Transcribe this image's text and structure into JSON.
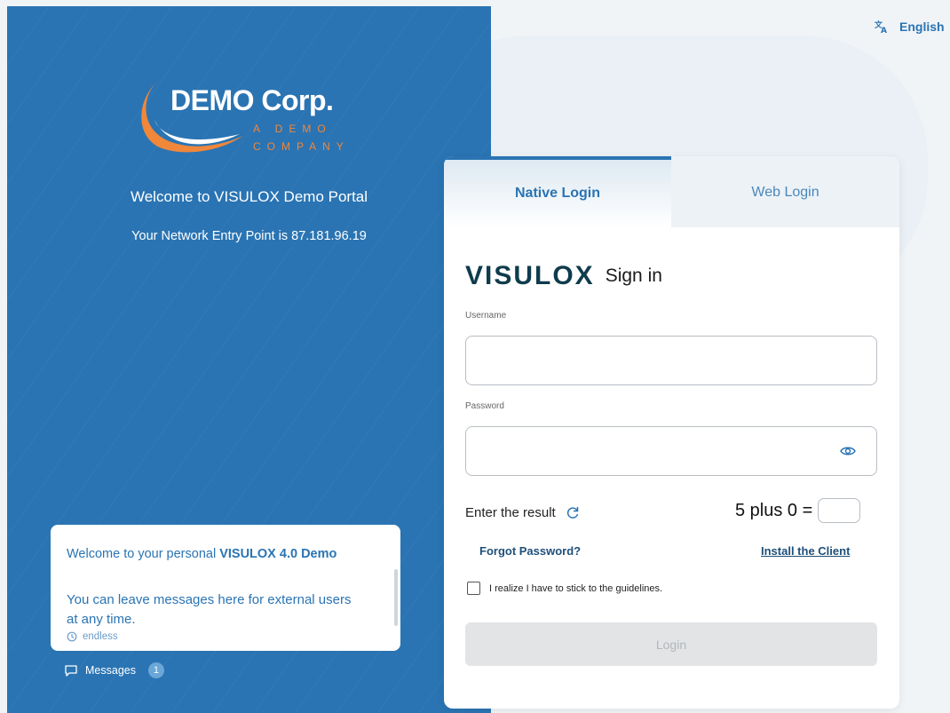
{
  "branding": {
    "company_name": "DEMO Corp.",
    "tagline_line1": "A DEMO",
    "tagline_line2": "COMPANY",
    "accent_orange": "#f0873a",
    "primary_blue": "#2a74b3"
  },
  "welcome": {
    "title": "Welcome to VISULOX Demo Portal",
    "entry_point": "Your Network Entry Point is 87.181.96.19"
  },
  "message_box": {
    "line1_prefix": "Welcome to your personal ",
    "line1_bold": "VISULOX 4.0 Demo",
    "line2": "You can leave messages here for external users at any time.",
    "expiry": "endless",
    "expiry_icon": "timer-icon"
  },
  "messages": {
    "label": "Messages",
    "count": "1",
    "icon": "chat-bubble-icon"
  },
  "language": {
    "label": "English",
    "icon": "translate-icon"
  },
  "tabs": [
    {
      "label": "Native Login",
      "active": true
    },
    {
      "label": "Web Login",
      "active": false
    }
  ],
  "login": {
    "brand": "VISULOX",
    "title": "Sign in",
    "username_label": "Username",
    "username_value": "",
    "password_label": "Password",
    "password_value": "",
    "captcha_label": "Enter the result",
    "captcha_question": "5 plus 0 =",
    "captcha_value": "",
    "forgot_password": "Forgot Password?",
    "install_client": "Install the Client",
    "terms": "I realize I have to stick to the guidelines.",
    "terms_checked": false,
    "login_button": "Login"
  }
}
